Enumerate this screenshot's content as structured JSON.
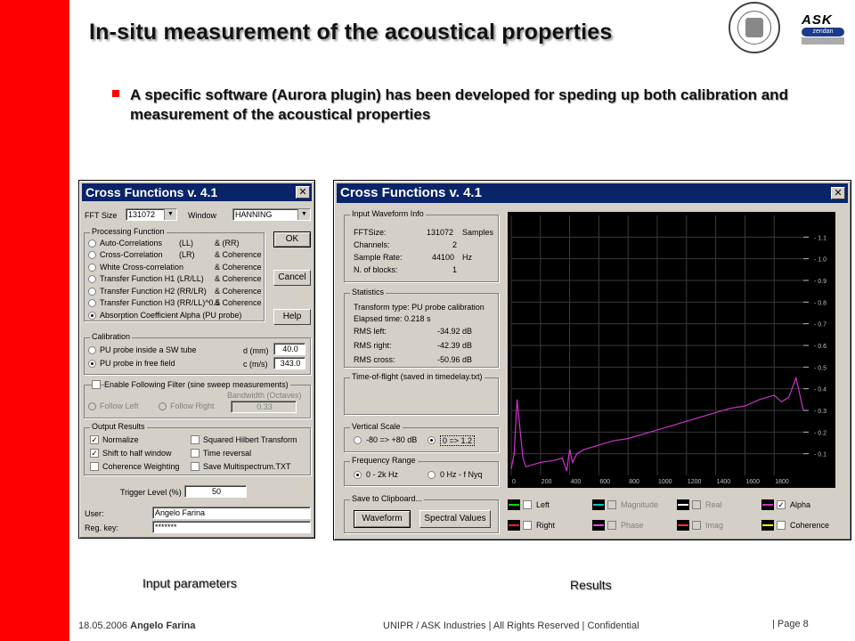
{
  "slide": {
    "title": "In-situ measurement of the acoustical properties",
    "bullet": "A specific software (Aurora plugin) has been developed for speding up both calibration and measurement of the acoustical properties",
    "caption_left": "Input parameters",
    "caption_right": "Results",
    "logo_text": "ASK",
    "logo_sub": "zendan",
    "footer_date": "18.05.2006",
    "footer_author": "Angelo Farina",
    "footer_center": "UNIPR / ASK Industries | All Rights Reserved | Confidential",
    "footer_page": "| Page 8",
    "accent_color": "#ff0000"
  },
  "input_win": {
    "title": "Cross Functions v. 4.1",
    "fft_label": "FFT Size",
    "fft_value": "131072",
    "window_label": "Window",
    "window_value": "HANNING",
    "processing_title": "Processing Function",
    "processing": [
      {
        "name": "Auto-Correlations",
        "a": "(LL)",
        "b": "& (RR)"
      },
      {
        "name": "Cross-Correlation",
        "a": "(LR)",
        "b": "& Coherence"
      },
      {
        "name": "White Cross-correlation",
        "a": "",
        "b": "& Coherence"
      },
      {
        "name": "Transfer Function H1 (LR/LL)",
        "a": "",
        "b": "& Coherence"
      },
      {
        "name": "Transfer Function H2 (RR/LR)",
        "a": "",
        "b": "& Coherence"
      },
      {
        "name": "Transfer Function H3 (RR/LL)^0.5",
        "a": "",
        "b": "& Coherence"
      },
      {
        "name": "Absorption Coefficient Alpha (PU probe)",
        "a": "",
        "b": ""
      }
    ],
    "ok_label": "OK",
    "cancel_label": "Cancel",
    "help_label": "Help",
    "calibration_title": "Calibration",
    "cal_option1": "PU probe inside a SW tube",
    "cal_option2": "PU probe in free field",
    "d_label": "d (mm)",
    "d_value": "40.0",
    "c_label": "c (m/s)",
    "c_value": "343.0",
    "filter_label": "Enable Following Filter (sine sweep measurements)",
    "bandwidth_label": "Bandwidth (Octaves)",
    "follow_left": "Follow Left",
    "follow_right": "Follow Right",
    "bandwidth_value": "0.33",
    "output_title": "Output Results",
    "out_normalize": "Normalize",
    "out_shift": "Shift to half window",
    "out_coherence": "Coherence Weighting",
    "out_squared": "Squared Hilbert Transform",
    "out_time": "Time reversal",
    "out_save": "Save Multispectrum.TXT",
    "trigger_label": "Trigger Level (%)",
    "trigger_value": "50",
    "user_label": "User:",
    "user_value": "Angelo Farina",
    "regkey_label": "Reg. key:",
    "regkey_value": "*******"
  },
  "result_win": {
    "title": "Cross Functions v. 4.1",
    "waveform_title": "Input Waveform Info",
    "fftsize_label": "FFTSize:",
    "fftsize_value": "131072",
    "fftsize_unit": "Samples",
    "channels_label": "Channels:",
    "channels_value": "2",
    "rate_label": "Sample Rate:",
    "rate_value": "44100",
    "rate_unit": "Hz",
    "blocks_label": "N. of blocks:",
    "blocks_value": "1",
    "stats_title": "Statistics",
    "stat_transform": "Transform type: PU probe calibration",
    "stat_elapsed": "Elapsed time: 0.218 s",
    "rms_left_label": "RMS left:",
    "rms_left_value": "-34.92 dB",
    "rms_right_label": "RMS right:",
    "rms_right_value": "-42.39 dB",
    "rms_cross_label": "RMS cross:",
    "rms_cross_value": "-50.96 dB",
    "tof_title": "Time-of-flight (saved in timedelay.txt)",
    "vscale_title": "Vertical Scale",
    "vscale_opt1": "-80 => +80 dB",
    "vscale_opt2": "0 => 1.2",
    "freq_title": "Frequency Range",
    "freq_opt1": "0 - 2k Hz",
    "freq_opt2": "0 Hz - f Nyq",
    "clip_title": "Save to Clipboard...",
    "waveform_btn": "Waveform",
    "spectral_btn": "Spectral Values",
    "legend": {
      "left": "Left",
      "right": "Right",
      "magnitude": "Magnitude",
      "phase": "Phase",
      "real": "Real",
      "imag": "Imag",
      "alpha": "Alpha",
      "coherence": "Coherence"
    }
  },
  "chart_data": {
    "type": "line",
    "series": [
      {
        "name": "Alpha"
      }
    ],
    "x_ticks": [
      "0",
      "200",
      "400",
      "600",
      "800",
      "1000",
      "1200",
      "1400",
      "1600",
      "1800"
    ],
    "y_ticks": [
      "1.1",
      "1.0",
      "0.9",
      "0.8",
      "0.7",
      "0.6",
      "0.5",
      "0.4",
      "0.3",
      "0.2",
      "0.1"
    ],
    "xlim": [
      0,
      2000
    ],
    "ylim": [
      0,
      1.2
    ],
    "x": [
      0,
      20,
      40,
      80,
      100,
      150,
      200,
      300,
      350,
      380,
      400,
      420,
      450,
      500,
      600,
      700,
      800,
      900,
      1000,
      1100,
      1200,
      1300,
      1400,
      1500,
      1600,
      1700,
      1750,
      1800,
      1850,
      1900,
      1950,
      2000
    ],
    "alpha": [
      0.03,
      0.1,
      0.35,
      0.08,
      0.04,
      0.05,
      0.06,
      0.07,
      0.08,
      0.02,
      0.12,
      0.06,
      0.1,
      0.12,
      0.14,
      0.16,
      0.17,
      0.19,
      0.21,
      0.23,
      0.25,
      0.27,
      0.29,
      0.31,
      0.32,
      0.35,
      0.36,
      0.37,
      0.34,
      0.36,
      0.45,
      0.3
    ],
    "grid": "on",
    "colors": {
      "background": "#000000",
      "grid": "#3a3a3a",
      "alpha_line": "#cc33cc",
      "axis_text": "#c0c0c0"
    }
  }
}
